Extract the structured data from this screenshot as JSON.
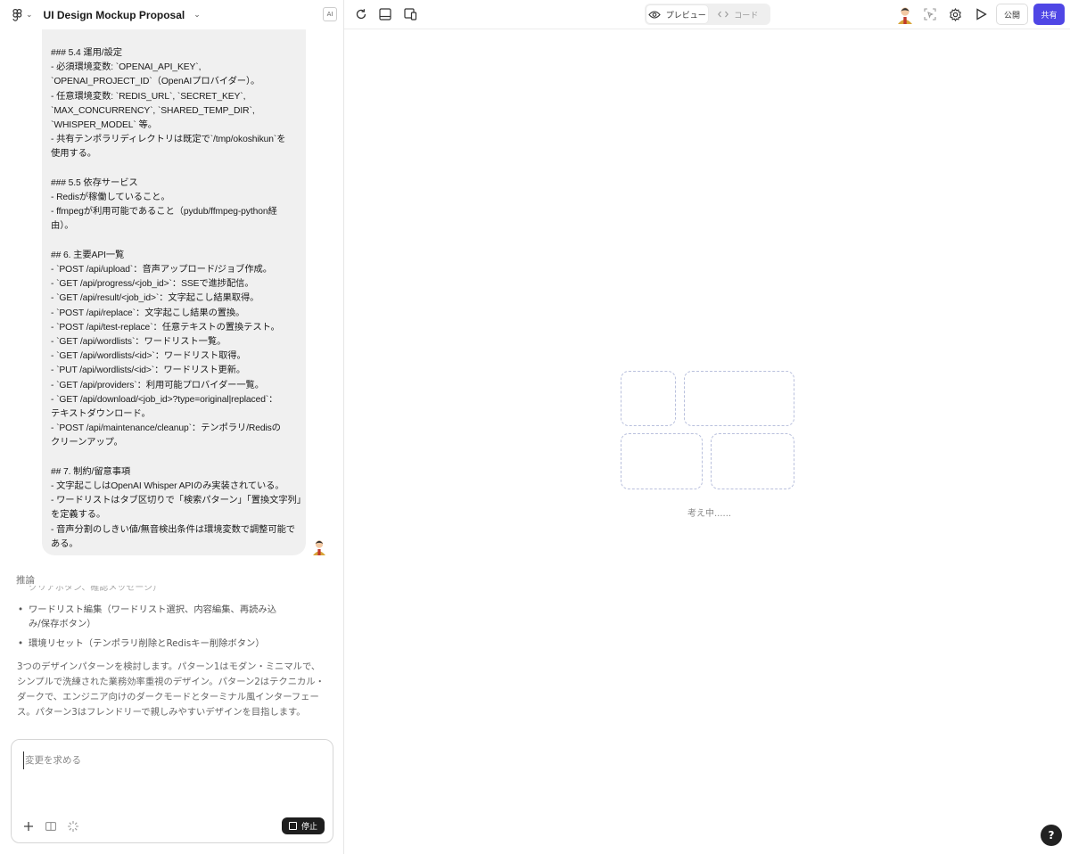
{
  "project": {
    "title": "UI Design Mockup Proposal",
    "ai_badge": "AI"
  },
  "chat": {
    "lines": [
      "### 5.4 運用/設定",
      "- 必須環境変数: `OPENAI_API_KEY`,",
      "`OPENAI_PROJECT_ID`（OpenAIプロバイダー）。",
      "- 任意環境変数: `REDIS_URL`, `SECRET_KEY`,",
      "`MAX_CONCURRENCY`, `SHARED_TEMP_DIR`,",
      "`WHISPER_MODEL` 等。",
      "- 共有テンポラリディレクトリは既定で`/tmp/okoshikun`を",
      "使用する。",
      "",
      "### 5.5 依存サービス",
      "- Redisが稼働していること。",
      "- ffmpegが利用可能であること（pydub/ffmpeg-python経",
      "由）。",
      "",
      "## 6. 主要API一覧",
      "- `POST /api/upload`：音声アップロード/ジョブ作成。",
      "- `GET /api/progress/<job_id>`：SSEで進捗配信。",
      "- `GET /api/result/<job_id>`：文字起こし結果取得。",
      "- `POST /api/replace`：文字起こし結果の置換。",
      "- `POST /api/test-replace`：任意テキストの置換テスト。",
      "- `GET /api/wordlists`：ワードリスト一覧。",
      "- `GET /api/wordlists/<id>`：ワードリスト取得。",
      "- `PUT /api/wordlists/<id>`：ワードリスト更新。",
      "- `GET /api/providers`：利用可能プロバイダー一覧。",
      "- `GET /api/download/<job_id>?type=original|replaced`：",
      "テキストダウンロード。",
      "- `POST /api/maintenance/cleanup`：テンポラリ/Redisの",
      "クリーンアップ。",
      "",
      "## 7. 制約/留意事項",
      "- 文字起こしはOpenAI Whisper APIのみ実装されている。",
      "- ワードリストはタブ区切りで「検索パターン」「置換文字列」",
      "を定義する。",
      "- 音声分割のしきい値/無音検出条件は環境変数で調整可能で",
      "ある。"
    ]
  },
  "reasoning": {
    "label": "推論",
    "cut_text": "クリアボタン、確認メッセージ）",
    "items": [
      "ワードリスト編集（ワードリスト選択、内容編集、再読み込み/保存ボタン）",
      "環境リセット（テンポラリ削除とRedisキー削除ボタン）"
    ],
    "paragraph": "3つのデザインパターンを検討します。パターン1はモダン・ミニマルで、シンプルで洗練された業務効率重視のデザイン。パターン2はテクニカル・ダークで、エンジニア向けのダークモードとターミナル風インターフェース。パターン3はフレンドリーで親しみやすいデザインを目指します。"
  },
  "input": {
    "placeholder": "変更を求める",
    "stop_label": "停止"
  },
  "toolbar": {
    "preview_label": "プレビュー",
    "code_label": "コード",
    "publish_label": "公開",
    "share_label": "共有"
  },
  "preview": {
    "thinking_label": "考え中......"
  },
  "help": {
    "label": "?"
  },
  "colors": {
    "accent": "#4f46e5",
    "bubble": "#f0f0f0",
    "placeholder_border": "#b9c0dd"
  }
}
